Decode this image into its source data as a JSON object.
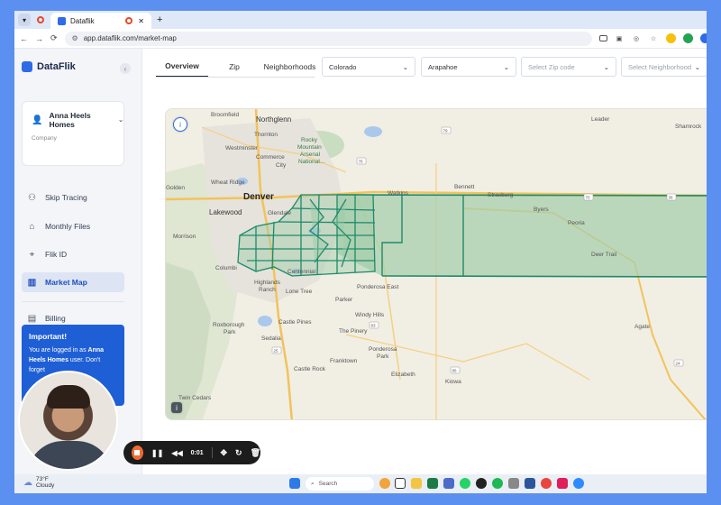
{
  "browser": {
    "tab_title": "Dataflik",
    "new_tab": "+",
    "close": "✕",
    "url": "app.dataflik.com/market-map"
  },
  "sidebar": {
    "brand": "DataFlik",
    "account_name": "Anna Heels Homes",
    "company_label": "Company",
    "items": [
      {
        "label": "Skip Tracing",
        "icon": "users-icon"
      },
      {
        "label": "Monthly Files",
        "icon": "home-icon"
      },
      {
        "label": "Flik ID",
        "icon": "id-icon"
      },
      {
        "label": "Market Map",
        "icon": "map-icon"
      },
      {
        "label": "Billing",
        "icon": "briefcase-icon"
      }
    ],
    "notice_title": "Important!",
    "notice_text_1": "You are logged in as",
    "notice_bold": "Anna Heels Homes",
    "notice_text_2": "user. Don't forget"
  },
  "main": {
    "tabs": [
      "Overview",
      "Zip",
      "Neighborhoods"
    ],
    "filters": {
      "state": "Colorado",
      "county": "Arapahoe",
      "zip_placeholder": "Select Zip code",
      "neighborhood_placeholder": "Select Neighborhood"
    }
  },
  "map": {
    "labels": {
      "broomfield": "Broomfield",
      "thornton": "Thornton",
      "northglenn": "Northglenn",
      "westminster": "Westminster",
      "rocky": "Rocky",
      "mountain": "Mountain",
      "arsenal": "Arsenal",
      "national": "National...",
      "commerce": "Commerce",
      "city": "City",
      "golden": "Golden",
      "wheat_ridge": "Wheat Ridge",
      "bennett": "Bennett",
      "watkins": "Watkins",
      "strasburg": "Strasburg",
      "denver": "Denver",
      "lakewood": "Lakewood",
      "glendale": "Glendale",
      "byers": "Byers",
      "peoria": "Peoria",
      "morrison": "Morrison",
      "deer_trail": "Deer Trail",
      "columbine": "Columbi",
      "centennial": "Centennial",
      "highlands": "Highlands",
      "ranch": "Ranch",
      "lone_tree": "Lone Tree",
      "ponderosa_east": "Ponderosa East",
      "parker": "Parker",
      "castle_pines": "Castle Pines",
      "windy_hills": "Windy Hills",
      "agate": "Agate",
      "roxborough": "Roxborough",
      "park": "Park",
      "sedalia": "Sedalia",
      "the_pinery": "The Pinery",
      "ponderosa": "Ponderosa",
      "ponderosa_park": "Park",
      "castle_rock": "Castle Rock",
      "franktown": "Franktown",
      "elizabeth": "Elizabeth",
      "kiowa": "Kiowa",
      "twin_cedars": "Twin Cedars",
      "leader": "Leader",
      "shamrock": "Shamrock",
      "i70": "70",
      "r36": "36",
      "r79": "79",
      "r83": "83",
      "r86": "86",
      "r24": "24",
      "r25": "25",
      "r76": "76"
    },
    "info_button": "i"
  },
  "recorder": {
    "time": "0:01"
  },
  "taskbar": {
    "temp": "73°F",
    "condition": "Cloudy",
    "search": "Search"
  },
  "colors": {
    "accent": "#2e6be6",
    "territory": "#1e8a6a",
    "territory_fill": "#9fc8a8",
    "recorder_stop": "#f26a33"
  }
}
